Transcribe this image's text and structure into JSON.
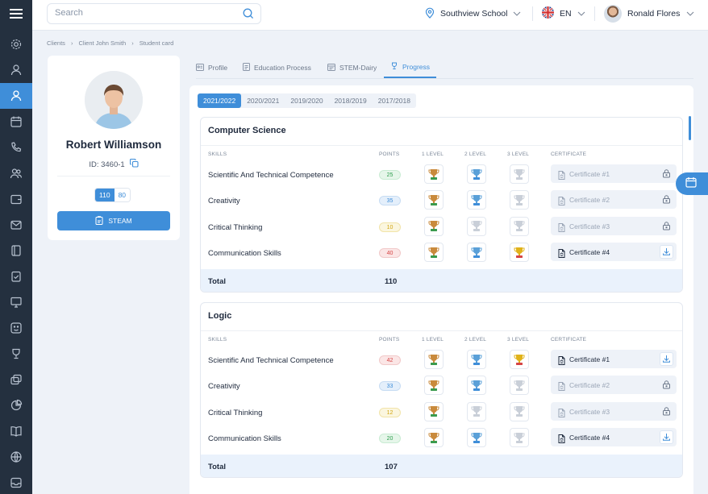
{
  "header": {
    "search_placeholder": "Search",
    "school": "Southview School",
    "language": "EN",
    "user_name": "Ronald Flores"
  },
  "breadcrumb": [
    "Clients",
    "Client John Smith",
    "Student card"
  ],
  "profile": {
    "name": "Robert Williamson",
    "id_label": "ID: 3460-1",
    "points_active": "110",
    "points_other": "80",
    "steam_label": "STEAM"
  },
  "tabs": [
    "Profile",
    "Education Process",
    "STEM-Dairy",
    "Progress"
  ],
  "active_tab": "Progress",
  "years": [
    "2021/2022",
    "2020/2021",
    "2019/2020",
    "2018/2019",
    "2017/2018"
  ],
  "active_year": "2021/2022",
  "columns": {
    "skills": "SKILLS",
    "points": "POINTS",
    "level1": "1 LEVEL",
    "level2": "2 LEVEL",
    "level3": "3 LEVEL",
    "certificate": "CERTIFICATE"
  },
  "total_label": "Total",
  "colors": {
    "accent": "#3f8ed9",
    "sidebar": "#24303f",
    "trophy_bronze": "#c98a3c",
    "trophy_silver": "#5aa0d8",
    "trophy_gold": "#e0b21a",
    "trophy_off": "#c9cfd8"
  },
  "subjects": [
    {
      "title": "Computer Science",
      "total": "110",
      "rows": [
        {
          "skill": "Scientific And Technical Competence",
          "points": "25",
          "points_color": "green",
          "levels": [
            "bronze",
            "silver",
            "off"
          ],
          "certificate": "Certificate #1",
          "cert_enabled": false
        },
        {
          "skill": "Creativity",
          "points": "35",
          "points_color": "blue",
          "levels": [
            "bronze",
            "silver",
            "off"
          ],
          "certificate": "Certificate #2",
          "cert_enabled": false
        },
        {
          "skill": "Critical Thinking",
          "points": "10",
          "points_color": "yellow",
          "levels": [
            "bronze",
            "off",
            "off"
          ],
          "certificate": "Certificate #3",
          "cert_enabled": false
        },
        {
          "skill": "Communication Skills",
          "points": "40",
          "points_color": "red",
          "levels": [
            "bronze",
            "silver",
            "gold"
          ],
          "certificate": "Certificate #4",
          "cert_enabled": true
        }
      ]
    },
    {
      "title": "Logic",
      "total": "107",
      "rows": [
        {
          "skill": "Scientific And Technical Competence",
          "points": "42",
          "points_color": "red",
          "levels": [
            "bronze",
            "silver",
            "gold"
          ],
          "certificate": "Certificate #1",
          "cert_enabled": true
        },
        {
          "skill": "Creativity",
          "points": "33",
          "points_color": "blue",
          "levels": [
            "bronze",
            "silver",
            "off"
          ],
          "certificate": "Certificate #2",
          "cert_enabled": false
        },
        {
          "skill": "Critical Thinking",
          "points": "12",
          "points_color": "yellow",
          "levels": [
            "bronze",
            "off",
            "off"
          ],
          "certificate": "Certificate #3",
          "cert_enabled": false
        },
        {
          "skill": "Communication Skills",
          "points": "20",
          "points_color": "green",
          "levels": [
            "bronze",
            "silver",
            "off"
          ],
          "certificate": "Certificate #4",
          "cert_enabled": true
        }
      ]
    }
  ]
}
